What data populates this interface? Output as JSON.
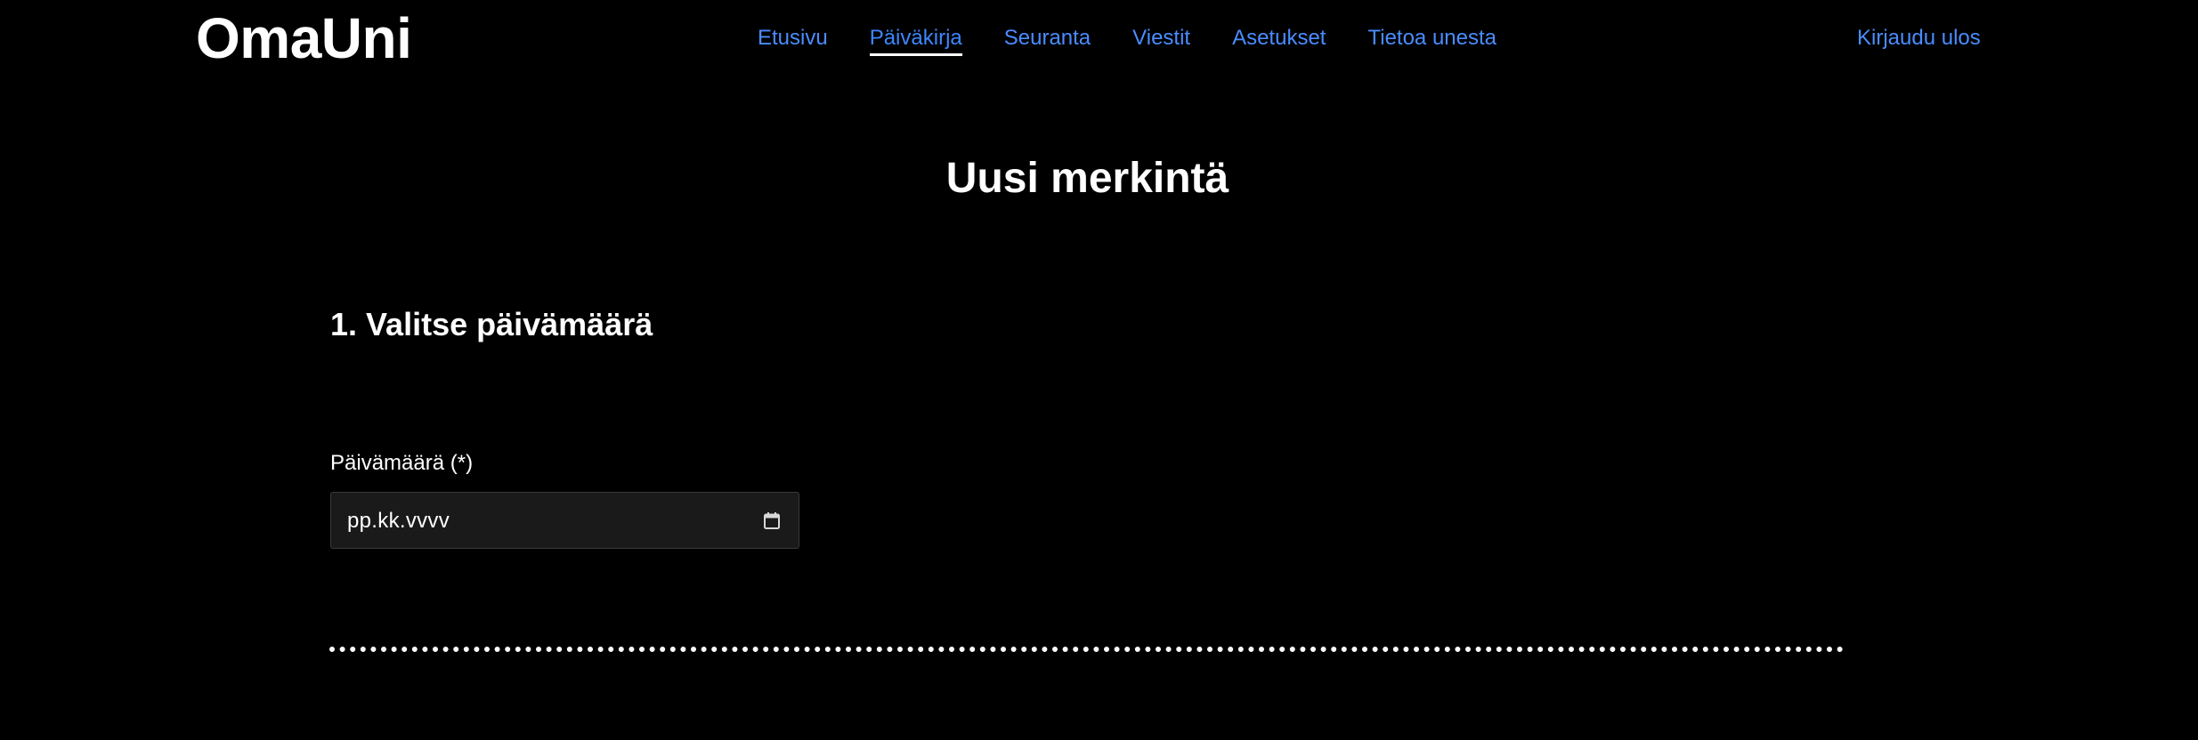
{
  "header": {
    "logo": "OmaUni",
    "nav": [
      {
        "label": "Etusivu",
        "active": false
      },
      {
        "label": "Päiväkirja",
        "active": true
      },
      {
        "label": "Seuranta",
        "active": false
      },
      {
        "label": "Viestit",
        "active": false
      },
      {
        "label": "Asetukset",
        "active": false
      },
      {
        "label": "Tietoa unesta",
        "active": false
      }
    ],
    "logout_label": "Kirjaudu ulos"
  },
  "main": {
    "title": "Uusi merkintä",
    "section_title": "1. Valitse päivämäärä",
    "date_field": {
      "label": "Päivämäärä (*)",
      "placeholder": "pp.kk.vvvv",
      "icon": "calendar-icon"
    },
    "divider_style": "dotted"
  },
  "colors": {
    "background": "#000000",
    "link": "#4a8cff",
    "text": "#ffffff",
    "input_background": "#1a1a1a"
  }
}
